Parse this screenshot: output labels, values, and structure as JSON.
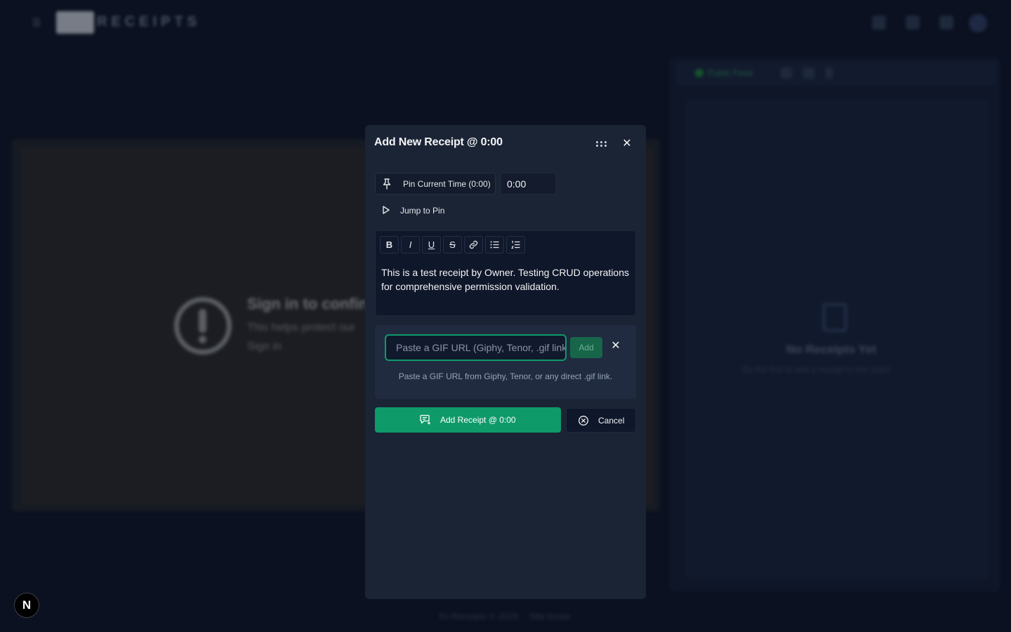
{
  "app": {
    "logo_text": "RECEIPTS"
  },
  "background": {
    "video_notice": {
      "title": "Sign in to confirm",
      "subtitle": "This helps protect our",
      "link": "Sign in"
    },
    "right_panel": {
      "tab_label": "Public Feed",
      "empty_title": "No Receipts Yet",
      "empty_subtitle": "Be the first to add a receipt to this video"
    },
    "footer": {
      "copyright": "Yo Receipts © 2025",
      "link": "Site footer"
    }
  },
  "modal": {
    "title": "Add New Receipt @ 0:00",
    "pin_button_label": "Pin Current Time (0:00)",
    "time_value": "0:00",
    "jump_label": "Jump to Pin",
    "toolbar": {
      "bold": "B",
      "italic": "I",
      "underline": "U",
      "strike": "S"
    },
    "editor_text": "This is a test receipt by Owner. Testing CRUD operations for comprehensive permission validation.",
    "gif": {
      "placeholder": "Paste a GIF URL (Giphy, Tenor, .gif link)",
      "add_label": "Add",
      "hint": "Paste a GIF URL from Giphy, Tenor, or any direct .gif link."
    },
    "submit_label": "Add Receipt @ 0:00",
    "cancel_label": "Cancel"
  },
  "next_badge": "N",
  "colors": {
    "accent": "#0f9a6a",
    "modal_bg": "#1b2435",
    "page_bg": "#0b1120"
  }
}
